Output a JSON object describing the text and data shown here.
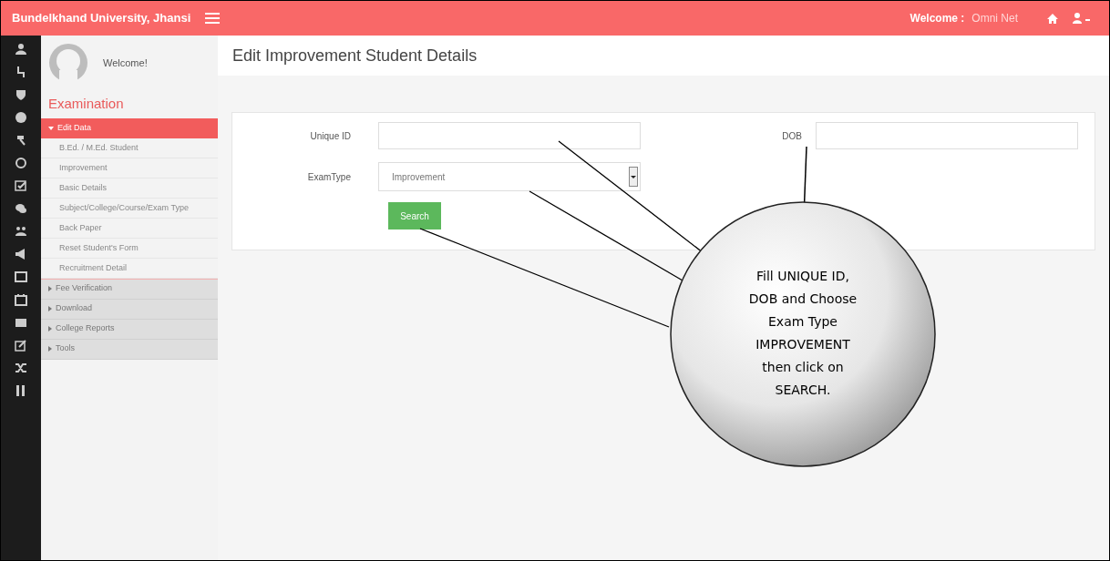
{
  "topbar": {
    "brand": "Bundelkhand University, Jhansi",
    "welcome_label": "Welcome :",
    "user": "Omni Net"
  },
  "sidebar": {
    "greeting": "Welcome!",
    "section": "Examination",
    "items": [
      {
        "label": "Edit Data",
        "selected": true,
        "expanded": true,
        "children": [
          {
            "label": "B.Ed. / M.Ed. Student"
          },
          {
            "label": "Improvement"
          },
          {
            "label": "Basic Details"
          },
          {
            "label": "Subject/College/Course/Exam Type"
          },
          {
            "label": "Back Paper"
          },
          {
            "label": "Reset Student's Form"
          },
          {
            "label": "Recruitment Detail"
          }
        ]
      },
      {
        "label": "Fee Verification",
        "selected": false,
        "expanded": false
      },
      {
        "label": "Download",
        "selected": false,
        "expanded": false
      },
      {
        "label": "College Reports",
        "selected": false,
        "expanded": false
      },
      {
        "label": "Tools",
        "selected": false,
        "expanded": false
      }
    ]
  },
  "page": {
    "title": "Edit Improvement Student Details"
  },
  "form": {
    "unique_id": {
      "label": "Unique ID"
    },
    "dob": {
      "label": "DOB"
    },
    "exam_type": {
      "label": "ExamType",
      "value": "Improvement"
    },
    "button": "Search"
  },
  "callout": {
    "text": "Fill UNIQUE ID, DOB and Choose Exam Type IMPROVEMENT then click on SEARCH."
  }
}
